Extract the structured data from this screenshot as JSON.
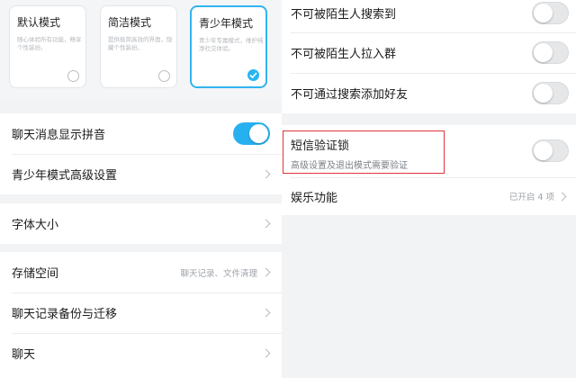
{
  "modes": [
    {
      "title": "默认模式",
      "desc": "随心体验所有功能，畅享个性装扮。",
      "selected": false
    },
    {
      "title": "简洁模式",
      "desc": "提供极简高效的界面，隐藏个性装扮。",
      "selected": false
    },
    {
      "title": "青少年模式",
      "desc": "青少年专属模式，维护纯净社交体验。",
      "selected": true
    }
  ],
  "left": {
    "pinyin_label": "聊天消息显示拼音",
    "pinyin_on": true,
    "teen_advanced_label": "青少年模式高级设置",
    "font_size_label": "字体大小",
    "storage_label": "存储空间",
    "storage_value": "聊天记录、文件清理",
    "backup_label": "聊天记录备份与迁移",
    "chat_label": "聊天"
  },
  "right": {
    "no_search_label": "不可被陌生人搜索到",
    "no_search_on": false,
    "no_group_label": "不可被陌生人拉入群",
    "no_group_on": false,
    "no_add_label": "不可通过搜索添加好友",
    "no_add_on": false,
    "sms_lock_label": "短信验证锁",
    "sms_lock_sub": "高级设置及退出模式需要验证",
    "sms_lock_on": false,
    "entertainment_label": "娱乐功能",
    "entertainment_value": "已开启 4 项"
  },
  "colors": {
    "accent": "#27b0f0",
    "highlight": "#e0353a"
  }
}
